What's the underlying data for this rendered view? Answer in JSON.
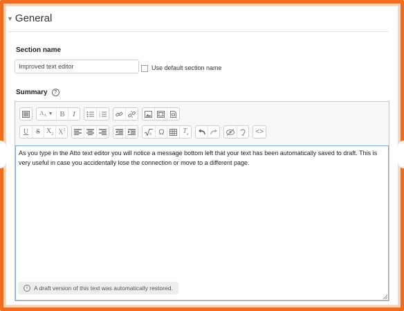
{
  "section": {
    "header": "General",
    "name_label": "Section name",
    "name_value": "Improved text editor",
    "default_checkbox_label": "Use default section name"
  },
  "summary": {
    "label": "Summary",
    "help_icon": "question-circle-icon",
    "toolbar": {
      "row1": [
        [
          "collapse-toolbar-icon"
        ],
        [
          "paragraph-style-icon",
          "bold-icon",
          "italic-icon"
        ],
        [
          "unordered-list-icon",
          "ordered-list-icon"
        ],
        [
          "link-icon",
          "unlink-icon"
        ],
        [
          "image-icon",
          "media-icon",
          "file-icon"
        ]
      ],
      "row2": [
        [
          "underline-icon",
          "strikethrough-icon",
          "subscript-icon",
          "superscript-icon"
        ],
        [
          "align-left-icon",
          "align-center-icon",
          "align-right-icon"
        ],
        [
          "outdent-icon",
          "indent-icon"
        ],
        [
          "equation-icon",
          "special-char-icon",
          "table-icon",
          "clear-format-icon"
        ],
        [
          "undo-icon",
          "redo-icon"
        ],
        [
          "accessibility-checker-icon",
          "screenreader-helper-icon"
        ],
        [
          "html-source-icon"
        ]
      ]
    },
    "content_text": "As you type in the Atto text editor you will notice a message bottom left that your text has been automatically saved to draft. This is very useful in case you accidentally lose the connection or move to a different page.",
    "autosave_notice": "A draft version of this text was automatically restored."
  }
}
